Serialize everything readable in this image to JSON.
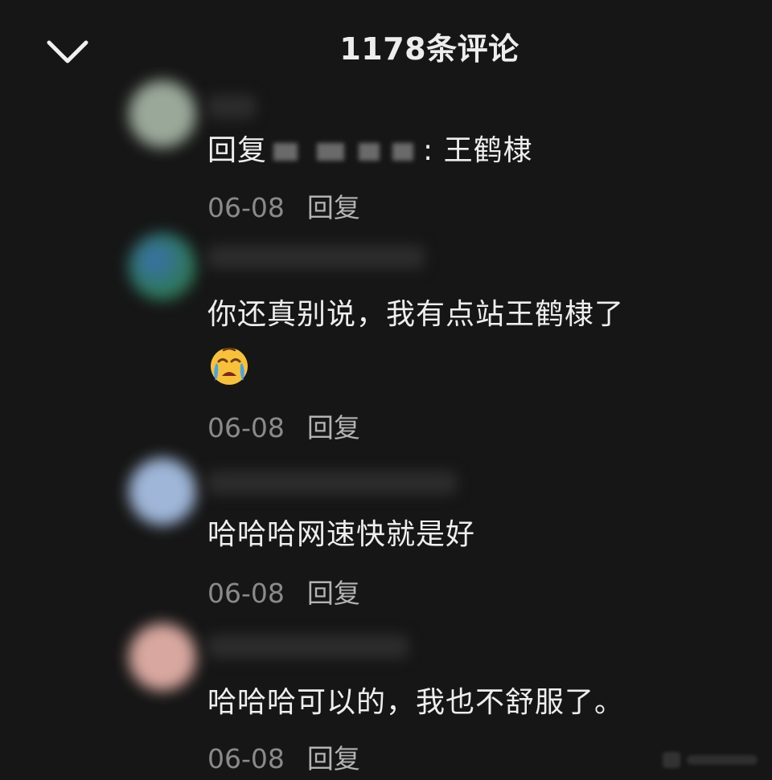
{
  "header": {
    "title": "1178条评论",
    "collapse_icon": "chevron-down-icon"
  },
  "comments": [
    {
      "reply_prefix": "回复",
      "text": ": 王鹤棣",
      "date": "06-08",
      "reply_label": "回复",
      "avatar_color": "#9aa89a"
    },
    {
      "text": "你还真别说，我有点站王鹤棣了",
      "emoji": "crying-face-icon",
      "date": "06-08",
      "reply_label": "回复",
      "avatar_color": "#3f7f6a"
    },
    {
      "text": "哈哈哈网速快就是好",
      "date": "06-08",
      "reply_label": "回复",
      "avatar_color": "#9fb6d8"
    },
    {
      "text": "哈哈哈可以的，我也不舒服了。",
      "date": "06-08",
      "reply_label": "回复",
      "avatar_color": "#d8a8a0"
    }
  ],
  "colors": {
    "background": "#161616",
    "text_primary": "#eeeeee",
    "text_secondary": "#8a8a8a"
  }
}
